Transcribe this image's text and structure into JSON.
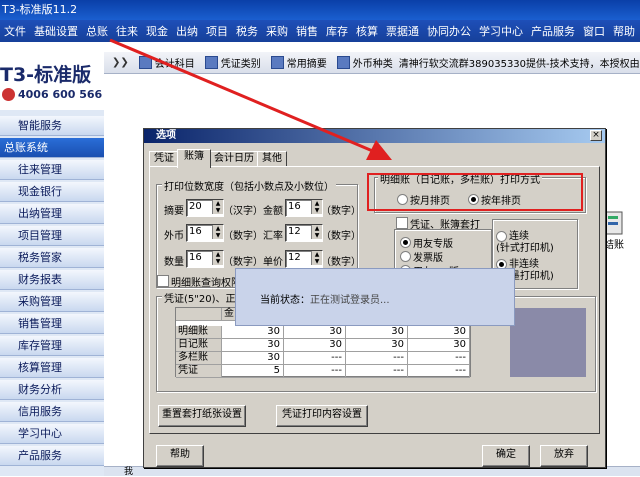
{
  "window": {
    "title": "T3-标准版11.2"
  },
  "menu": [
    "文件",
    "基础设置",
    "总账",
    "往来",
    "现金",
    "出纳",
    "项目",
    "税务",
    "采购",
    "销售",
    "库存",
    "核算",
    "票据通",
    "协同办公",
    "学习中心",
    "产品服务",
    "窗口",
    "帮助"
  ],
  "logo": {
    "text": "T3-标准版",
    "phone": "4006 600 566"
  },
  "sidebar": {
    "items": [
      {
        "label": "智能服务",
        "selected": false
      },
      {
        "label": "总账系统",
        "selected": true
      },
      {
        "label": "往来管理",
        "selected": false
      },
      {
        "label": "现金银行",
        "selected": false
      },
      {
        "label": "出纳管理",
        "selected": false
      },
      {
        "label": "项目管理",
        "selected": false
      },
      {
        "label": "税务管家",
        "selected": false
      },
      {
        "label": "财务报表",
        "selected": false
      },
      {
        "label": "采购管理",
        "selected": false
      },
      {
        "label": "销售管理",
        "selected": false
      },
      {
        "label": "库存管理",
        "selected": false
      },
      {
        "label": "核算管理",
        "selected": false
      },
      {
        "label": "财务分析",
        "selected": false
      },
      {
        "label": "信用服务",
        "selected": false
      },
      {
        "label": "学习中心",
        "selected": false
      },
      {
        "label": "产品服务",
        "selected": false
      }
    ]
  },
  "toolbar": {
    "items": [
      "会计科目",
      "凭证类别",
      "常用摘要",
      "外币种类"
    ],
    "marquee": "清神行软交流群389035330提供-技术支持，本授权由清神射"
  },
  "desktop": {
    "right_label": "结账"
  },
  "bottom_strip": {
    "text": "我"
  },
  "dialog": {
    "title": "选项",
    "close_glyph": "×",
    "tabs": [
      {
        "label": "凭证",
        "active": false
      },
      {
        "label": "账簿",
        "active": true
      },
      {
        "label": "会计日历",
        "active": false
      },
      {
        "label": "其他",
        "active": false
      }
    ],
    "print_width": {
      "title": "打印位数宽度（包括小数点及小数位）",
      "fields": [
        {
          "label": "摘要",
          "value": "20",
          "unit": "（汉字）"
        },
        {
          "label": "金额",
          "value": "16",
          "unit": "（数字）"
        },
        {
          "label": "外币",
          "value": "16",
          "unit": "（数字）"
        },
        {
          "label": "汇率",
          "value": "12",
          "unit": "（数字）"
        },
        {
          "label": "数量",
          "value": "16",
          "unit": "（数字）"
        },
        {
          "label": "单价",
          "value": "12",
          "unit": "（数字）"
        }
      ]
    },
    "detail_print": {
      "title": "明细账（日记账，多栏账）打印方式",
      "options": [
        {
          "label": "按月排页",
          "selected": false
        },
        {
          "label": "按年排页",
          "selected": true
        }
      ]
    },
    "voucher_book": {
      "checkbox_label": "凭证、账簿套打",
      "options": [
        {
          "label": "用友专版",
          "selected": true
        },
        {
          "label": "发票版",
          "selected": false
        },
        {
          "label": "用友7.1版",
          "selected": false
        }
      ]
    },
    "continuous": {
      "options": [
        {
          "label": "连续",
          "sub": "(针式打印机)",
          "selected": false
        },
        {
          "label": "非连续",
          "sub": "(喷墨打印机)",
          "selected": true
        }
      ]
    },
    "query_perm_checkbox": "明细账查询权限",
    "voucher_table": {
      "title": "凭证(5\"20)、正式",
      "header": [
        "",
        "金"
      ],
      "rows": [
        {
          "name": "明细账",
          "values": [
            "30",
            "30",
            "30",
            "30"
          ]
        },
        {
          "name": "日记账",
          "values": [
            "30",
            "30",
            "30",
            "30"
          ]
        },
        {
          "name": "多栏账",
          "values": [
            "30",
            "---",
            "---",
            "---"
          ]
        },
        {
          "name": "凭证",
          "values": [
            "5",
            "---",
            "---",
            "---"
          ]
        }
      ]
    },
    "buttons": {
      "reset_template": "重置套打纸张设置",
      "voucher_print": "凭证打印内容设置",
      "help": "帮助",
      "ok": "确定",
      "cancel": "放弃"
    }
  },
  "loading": {
    "label": "当前状态：",
    "value": "正在测试登录员..."
  }
}
